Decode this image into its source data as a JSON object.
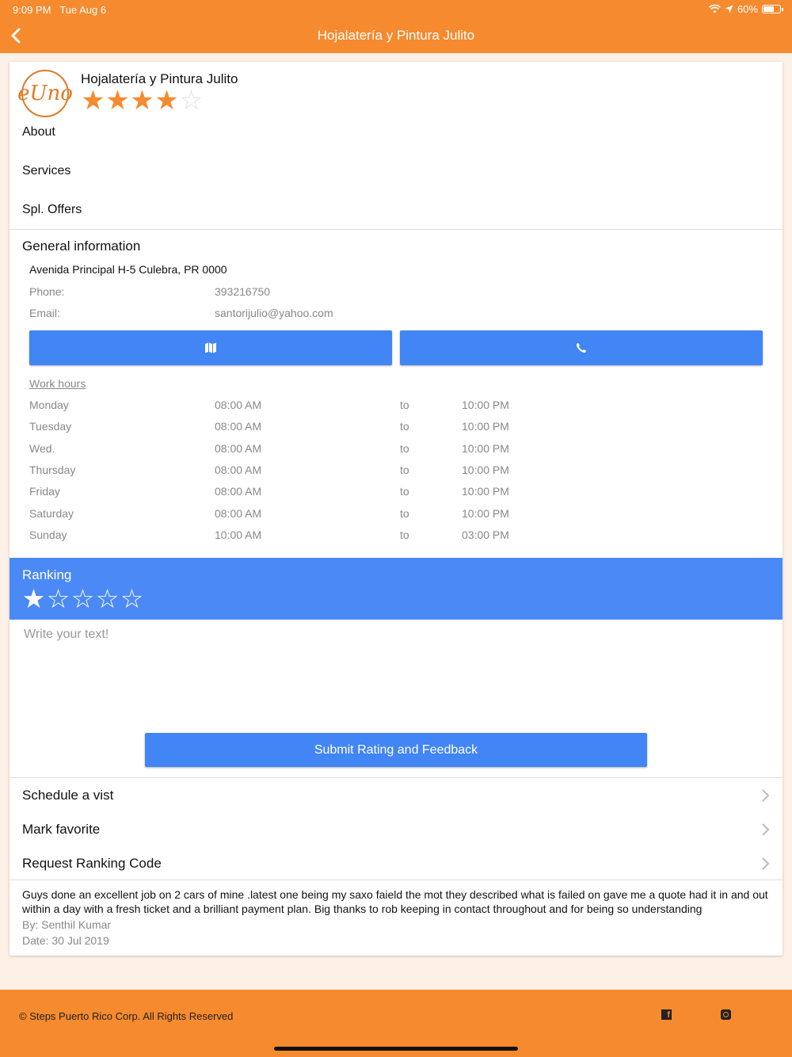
{
  "status_bar": {
    "time": "9:09 PM",
    "date": "Tue Aug 6",
    "battery": "60%"
  },
  "nav": {
    "title": "Hojalatería y Pintura Julito"
  },
  "business": {
    "logo_text": "eUno",
    "name": "Hojalatería y Pintura Julito",
    "rating": 4,
    "rating_max": 5
  },
  "menu": {
    "about": "About",
    "services": "Services",
    "offers": "Spl. Offers"
  },
  "general": {
    "title": "General information",
    "address": "Avenida Principal H-5 Culebra, PR 0000",
    "phone_label": "Phone:",
    "phone": "393216750",
    "email_label": "Email:",
    "email": "santorijulio@yahoo.com",
    "map_icon": "map-icon",
    "call_icon": "phone-icon"
  },
  "work_hours": {
    "title": "Work hours",
    "to_label": "to",
    "days": [
      {
        "day": "Monday",
        "open": "08:00 AM",
        "to": "to",
        "close": "10:00 PM"
      },
      {
        "day": "Tuesday",
        "open": "08:00 AM",
        "to": "to",
        "close": "10:00 PM"
      },
      {
        "day": "Wed.",
        "open": "08:00 AM",
        "to": "to",
        "close": "10:00 PM"
      },
      {
        "day": "Thursday",
        "open": "08:00 AM",
        "to": "to",
        "close": "10:00 PM"
      },
      {
        "day": "Friday",
        "open": "08:00 AM",
        "to": "to",
        "close": "10:00 PM"
      },
      {
        "day": "Saturday",
        "open": "08:00 AM",
        "to": "to",
        "close": "10:00 PM"
      },
      {
        "day": "Sunday",
        "open": "10:00 AM",
        "to": "to",
        "close": "03:00 PM"
      }
    ]
  },
  "ranking": {
    "title": "Ranking",
    "value": 1,
    "max": 5
  },
  "feedback": {
    "placeholder": "Write your text!",
    "value": "",
    "submit_label": "Submit Rating and Feedback"
  },
  "actions": {
    "schedule": "Schedule a vist",
    "favorite": "Mark favorite",
    "request_code": "Request Ranking Code"
  },
  "review": {
    "text": "Guys done an excellent job on 2 cars of mine .latest one being my saxo faield the mot they described what is failed on gave me a quote had it in and out within a day with a fresh ticket and a brilliant payment plan. Big thanks to rob keeping in contact throughout and for being so understanding",
    "by": "By: Senthil Kumar",
    "date": "Date: 30 Jul 2019"
  },
  "footer": {
    "copyright": "© Steps Puerto Rico Corp. All Rights Reserved",
    "facebook_glyph": "f"
  },
  "colors": {
    "accent": "#f58a2e",
    "button_blue": "#4285f4",
    "ranking_blue": "#4a89f6",
    "background": "#fdf0e6"
  }
}
